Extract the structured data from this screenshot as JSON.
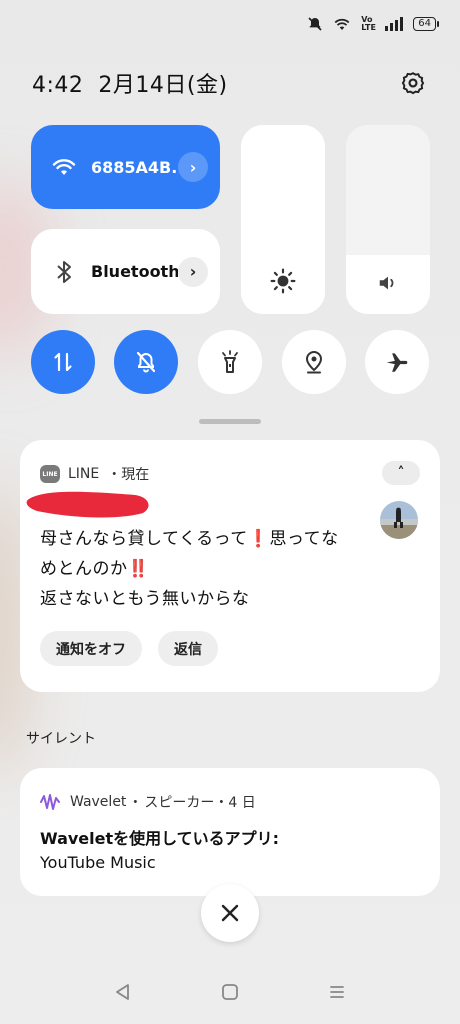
{
  "status_bar": {
    "icons": [
      "mute-icon",
      "wifi-icon",
      "volte-icon",
      "signal-icon"
    ],
    "volte_label": "Vo LTE",
    "battery": "64"
  },
  "header": {
    "time": "4:42",
    "date": "2月14日(金)",
    "settings_icon": "gear-icon"
  },
  "quick_tiles": {
    "wifi": {
      "label": "6885A4B..",
      "state": "on",
      "icon": "wifi-icon"
    },
    "bluetooth": {
      "label": "Bluetooth",
      "state": "off",
      "icon": "bluetooth-icon"
    },
    "brightness": {
      "icon": "sun-icon",
      "level": 0
    },
    "volume": {
      "icon": "speaker-icon",
      "level": 0.31
    },
    "toggles": [
      {
        "name": "mobile-data",
        "icon": "data-arrows-icon",
        "state": "on"
      },
      {
        "name": "mute",
        "icon": "bell-off-icon",
        "state": "on"
      },
      {
        "name": "flashlight",
        "icon": "flashlight-icon",
        "state": "off"
      },
      {
        "name": "location",
        "icon": "location-icon",
        "state": "off"
      },
      {
        "name": "airplane-mode",
        "icon": "airplane-icon",
        "state": "off"
      }
    ]
  },
  "notifications": [
    {
      "app": "LINE",
      "time": "現在",
      "message_lines": [
        "母さんなら貸してくるって❗思ってな",
        "めとんのか‼️",
        "返さないともう無いからな"
      ],
      "actions": [
        "通知をオフ",
        "返信"
      ]
    }
  ],
  "section_label": "サイレント",
  "silent_notification": {
    "app": "Wavelet",
    "meta": "スピーカー・4 日",
    "title": "Waveletを使用しているアプリ:",
    "body": "YouTube Music"
  },
  "nav": [
    "back-icon",
    "home-icon",
    "recents-icon"
  ],
  "colors": {
    "accent": "#2f7cf6",
    "redaction": "#e8283b",
    "wavelet": "#8d5bd9"
  }
}
